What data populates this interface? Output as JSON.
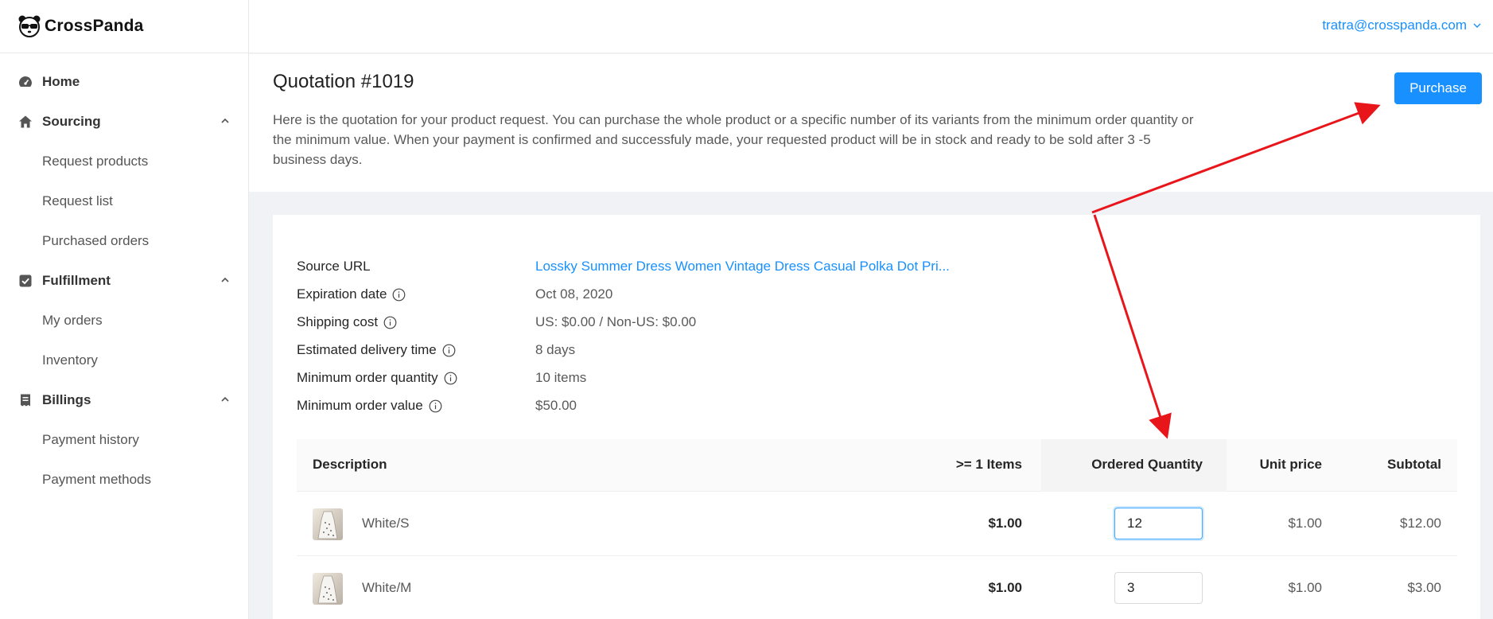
{
  "brand": {
    "name": "CrossPanda"
  },
  "header": {
    "user_email": "tratra@crosspanda.com"
  },
  "sidebar": {
    "items": [
      {
        "label": "Home",
        "icon": "dashboard-icon",
        "type": "top"
      },
      {
        "label": "Sourcing",
        "icon": "home-icon",
        "type": "top",
        "expanded": true
      },
      {
        "label": "Request products",
        "type": "sub"
      },
      {
        "label": "Request list",
        "type": "sub"
      },
      {
        "label": "Purchased orders",
        "type": "sub"
      },
      {
        "label": "Fulfillment",
        "icon": "check-square-icon",
        "type": "top",
        "expanded": true
      },
      {
        "label": "My orders",
        "type": "sub"
      },
      {
        "label": "Inventory",
        "type": "sub"
      },
      {
        "label": "Billings",
        "icon": "receipt-icon",
        "type": "top",
        "expanded": true
      },
      {
        "label": "Payment history",
        "type": "sub"
      },
      {
        "label": "Payment methods",
        "type": "sub"
      }
    ]
  },
  "page": {
    "title": "Quotation #1019",
    "description": "Here is the quotation for your product request. You can purchase the whole product or a specific number of its variants from the minimum order quantity or the minimum value. When your payment is confirmed and successfuly made, your requested product will be in stock and ready to be sold after 3 -5 business days.",
    "purchase_label": "Purchase"
  },
  "info": [
    {
      "label": "Source URL",
      "value": "Lossky Summer Dress Women Vintage Dress Casual Polka Dot Pri...",
      "has_info_icon": false,
      "is_link": true
    },
    {
      "label": "Expiration date",
      "value": "Oct 08, 2020",
      "has_info_icon": true
    },
    {
      "label": "Shipping cost",
      "value": "US: $0.00 / Non-US: $0.00",
      "has_info_icon": true
    },
    {
      "label": "Estimated delivery time",
      "value": "8 days",
      "has_info_icon": true
    },
    {
      "label": "Minimum order quantity",
      "value": "10 items",
      "has_info_icon": true
    },
    {
      "label": "Minimum order value",
      "value": "$50.00",
      "has_info_icon": true
    }
  ],
  "table": {
    "headers": [
      "Description",
      ">= 1 Items",
      "Ordered Quantity",
      "Unit price",
      "Subtotal"
    ],
    "rows": [
      {
        "variant": "White/S",
        "tier_price": "$1.00",
        "quantity": "12",
        "unit_price": "$1.00",
        "subtotal": "$12.00"
      },
      {
        "variant": "White/M",
        "tier_price": "$1.00",
        "quantity": "3",
        "unit_price": "$1.00",
        "subtotal": "$3.00"
      }
    ]
  },
  "colors": {
    "accent": "#1890ff",
    "annotation": "#e8161b"
  }
}
